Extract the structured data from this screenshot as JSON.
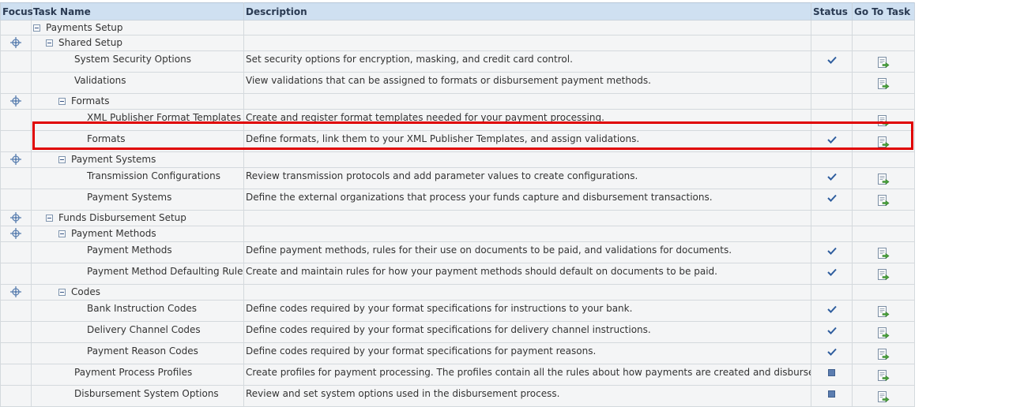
{
  "columns": {
    "focus": "Focus",
    "task_name": "Task Name",
    "description": "Description",
    "status": "Status",
    "go_to_task": "Go To Task"
  },
  "rows": [
    {
      "name": "Payments Setup",
      "description": "",
      "level": 0,
      "type": "section",
      "focus": false,
      "status": ""
    },
    {
      "name": "Shared Setup",
      "description": "",
      "level": 1,
      "type": "section",
      "focus": true,
      "status": ""
    },
    {
      "name": "System Security Options",
      "description": "Set security options for encryption, masking, and credit card control.",
      "level": 2,
      "type": "task",
      "status": "complete"
    },
    {
      "name": "Validations",
      "description": "View validations that can be assigned to formats or disbursement payment methods.",
      "level": 2,
      "type": "task",
      "status": ""
    },
    {
      "name": "Formats",
      "description": "",
      "level": 2,
      "type": "section",
      "focus": true,
      "status": ""
    },
    {
      "name": "XML Publisher Format Templates",
      "description": "Create and register format templates needed for your payment processing.",
      "level": 3,
      "type": "task",
      "status": ""
    },
    {
      "name": "Formats",
      "description": "Define formats, link them to your XML Publisher Templates, and assign validations.",
      "level": 3,
      "type": "task",
      "status": "complete",
      "highlighted": true
    },
    {
      "name": "Payment Systems",
      "description": "",
      "level": 2,
      "type": "section",
      "focus": true,
      "status": ""
    },
    {
      "name": "Transmission Configurations",
      "description": "Review transmission protocols and add parameter values to create configurations.",
      "level": 3,
      "type": "task",
      "status": "complete"
    },
    {
      "name": "Payment Systems",
      "description": "Define the external organizations that process your funds capture and disbursement transactions.",
      "level": 3,
      "type": "task",
      "status": "complete"
    },
    {
      "name": "Funds Disbursement Setup",
      "description": "",
      "level": 1,
      "type": "section",
      "focus": true,
      "status": ""
    },
    {
      "name": "Payment Methods",
      "description": "",
      "level": 2,
      "type": "section",
      "focus": true,
      "status": ""
    },
    {
      "name": "Payment Methods",
      "description": "Define payment methods, rules for their use on documents to be paid, and validations for documents.",
      "level": 3,
      "type": "task",
      "status": "complete"
    },
    {
      "name": "Payment Method Defaulting Rules",
      "description": "Create and maintain rules for how your payment methods should default on documents to be paid.",
      "level": 3,
      "type": "task",
      "status": "complete"
    },
    {
      "name": "Codes",
      "description": "",
      "level": 2,
      "type": "section",
      "focus": true,
      "status": ""
    },
    {
      "name": "Bank Instruction Codes",
      "description": "Define codes required by your format specifications for instructions to your bank.",
      "level": 3,
      "type": "task",
      "status": "complete"
    },
    {
      "name": "Delivery Channel Codes",
      "description": "Define codes required by your format specifications for delivery channel instructions.",
      "level": 3,
      "type": "task",
      "status": "complete"
    },
    {
      "name": "Payment Reason Codes",
      "description": "Define codes required by your format specifications for payment reasons.",
      "level": 3,
      "type": "task",
      "status": "complete"
    },
    {
      "name": "Payment Process Profiles",
      "description": "Create profiles for payment processing. The profiles contain all the rules about how payments are created and disbursed.",
      "level": 2,
      "type": "task",
      "status": "not-started"
    },
    {
      "name": "Disbursement System Options",
      "description": "Review and set system options used in the disbursement process.",
      "level": 2,
      "type": "task",
      "status": "not-started"
    }
  ],
  "icons": {
    "focus": "focus-crosshair-icon",
    "expander": "collapse-minus-icon",
    "status_complete": "checkmark-icon",
    "status_not_started": "square-icon",
    "go_to_task": "go-to-task-icon"
  },
  "colors": {
    "header_bg": "#cfe0f1",
    "row_bg": "#f4f5f6",
    "checkmark": "#2e5d9e",
    "highlight": "#e00000",
    "go_arrow": "#4aa23c"
  }
}
